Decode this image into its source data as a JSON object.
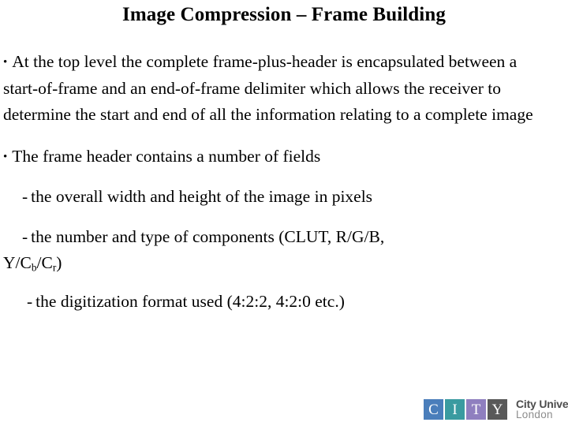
{
  "slide": {
    "title": "Image Compression – Frame Building",
    "background_color": "#ffffff",
    "text_color": "#000000",
    "bullets": [
      {
        "marker": "•",
        "text": "At the top level the complete frame-plus-header is encapsulated between a start-of-frame and an end-of-frame delimiter which allows the receiver to determine the start and end of all the information relating to a complete image"
      },
      {
        "marker": "•",
        "text": "The frame header contains a number of fields"
      }
    ],
    "sub_items": [
      {
        "marker": "-",
        "text": "the overall width and height of the image in pixels"
      },
      {
        "marker": "-",
        "text_part_1": "the number and type of components (CLUT, R/G/B,",
        "text_part_2_prefix": "Y/C",
        "text_part_2_sub_1": "b",
        "text_part_2_mid": "/C",
        "text_part_2_sub_2": "r",
        "text_part_2_suffix": ")"
      },
      {
        "marker": "-",
        "text": "the digitization format used (4:2:2, 4:2:0 etc.)"
      }
    ]
  },
  "logo": {
    "squares": [
      {
        "letter": "C",
        "color": "#4a7ebb"
      },
      {
        "letter": "I",
        "color": "#3a9ba0"
      },
      {
        "letter": "T",
        "color": "#8f7fbf"
      },
      {
        "letter": "Y",
        "color": "#595959"
      }
    ],
    "name": "City University",
    "sub": "London",
    "name_color": "#4d4d4d",
    "sub_color": "#8c8c8c"
  }
}
